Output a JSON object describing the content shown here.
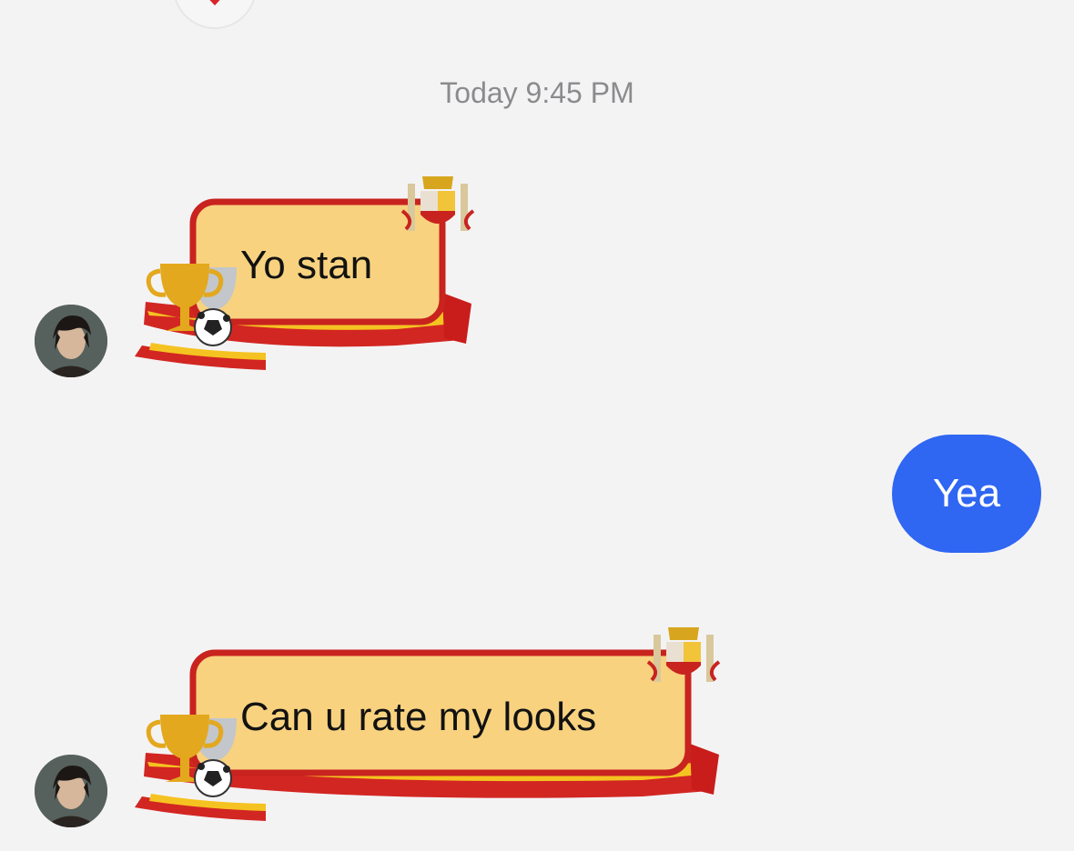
{
  "conversation": {
    "timestamp": "Today 9:45 PM",
    "messages": [
      {
        "direction": "incoming",
        "text": "Yo stan"
      },
      {
        "direction": "outgoing",
        "text": "Yea"
      },
      {
        "direction": "incoming",
        "text": "Can u rate my looks"
      }
    ]
  },
  "theme": {
    "bubble_fill": "#f8d27f",
    "bubble_border": "#c8231f",
    "scarf_red": "#d22622",
    "scarf_yellow": "#f5c321",
    "sent_bubble": "#2f66f2",
    "decorations": [
      "trophy-icon",
      "soccer-ball-icon",
      "coat-of-arms-icon",
      "scarf-icon"
    ]
  }
}
